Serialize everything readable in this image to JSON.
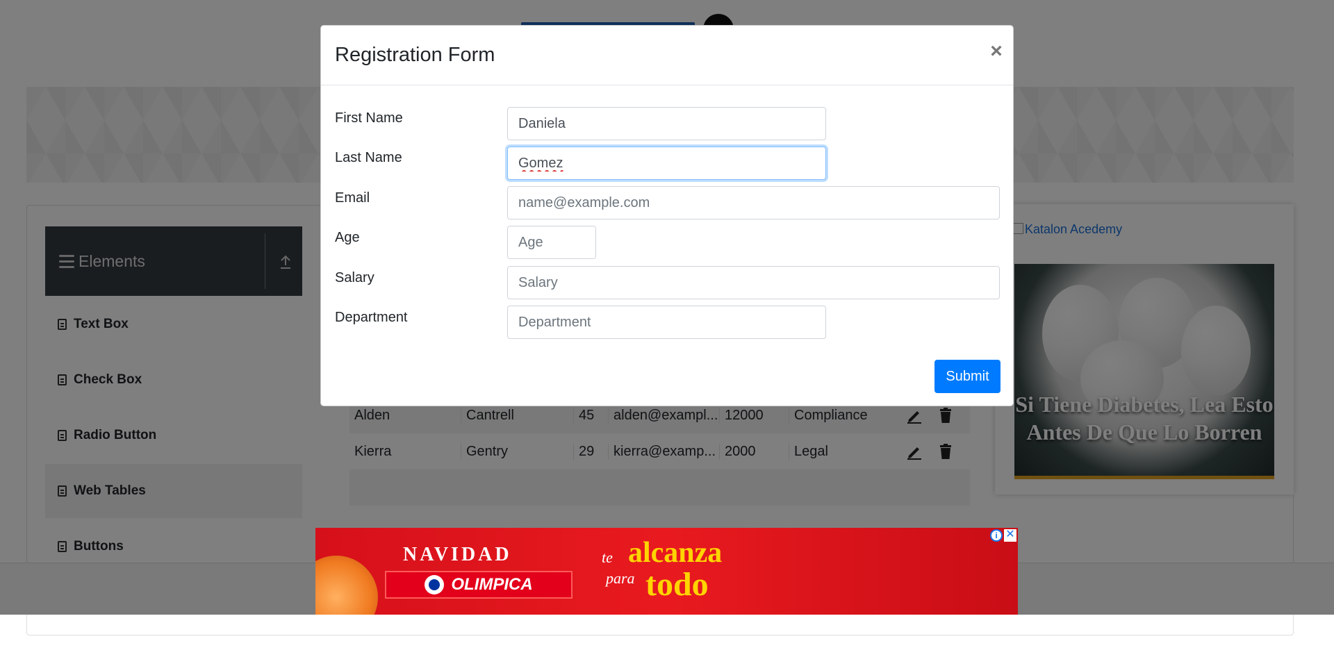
{
  "modal": {
    "title": "Registration Form",
    "close_label": "×",
    "fields": [
      {
        "label": "First Name",
        "value": "Daniela",
        "placeholder": "First Name"
      },
      {
        "label": "Last Name",
        "value": "Gomez",
        "placeholder": "Last Name"
      },
      {
        "label": "Email",
        "value": "",
        "placeholder": "name@example.com"
      },
      {
        "label": "Age",
        "value": "",
        "placeholder": "Age"
      },
      {
        "label": "Salary",
        "value": "",
        "placeholder": "Salary"
      },
      {
        "label": "Department",
        "value": "",
        "placeholder": "Department"
      }
    ],
    "submit_label": "Submit"
  },
  "sidebar": {
    "group_title": "Elements",
    "items": [
      {
        "label": "Text Box"
      },
      {
        "label": "Check Box"
      },
      {
        "label": "Radio Button"
      },
      {
        "label": "Web Tables"
      },
      {
        "label": "Buttons"
      }
    ]
  },
  "table": {
    "rows": [
      {
        "first": "Alden",
        "last": "Cantrell",
        "age": "45",
        "email": "alden@exampl...",
        "salary": "12000",
        "department": "Compliance"
      },
      {
        "first": "Kierra",
        "last": "Gentry",
        "age": "29",
        "email": "kierra@examp...",
        "salary": "2000",
        "department": "Legal"
      }
    ]
  },
  "side_ad": {
    "link_text": "Katalon Acedemy",
    "headline": "Si Tiene Diabetes, Lea Esto Antes De Que Lo Borren"
  },
  "bottom_ad": {
    "heading": "NAVIDAD",
    "brand": "OLIMPICA",
    "slogan_part1": "te",
    "slogan_part2": "alcanza",
    "slogan_part3": "para",
    "slogan_part4": "todo",
    "info_label": "i",
    "close_label": "✕"
  },
  "colors": {
    "accent": "#007bff",
    "sidebar_header": "#343a40",
    "promo_red": "#e81a1f",
    "promo_yellow": "#ffd400"
  }
}
